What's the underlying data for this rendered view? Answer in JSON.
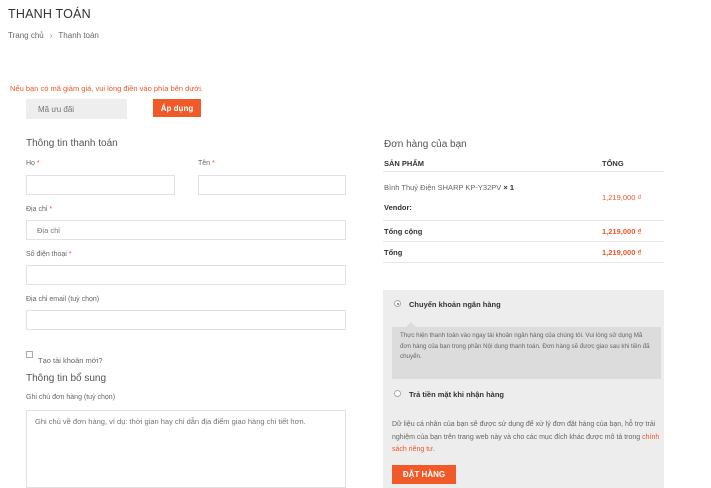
{
  "page": {
    "title": "THANH TOÁN"
  },
  "breadcrumb": {
    "home": "Trang chủ",
    "separator": "›",
    "current": "Thanh toán"
  },
  "coupon": {
    "note": "Nếu bạn có mã giảm giá, vui lòng điền vào phía bên dưới.",
    "placeholder": "Mã ưu đãi",
    "apply_label": "Áp dụng"
  },
  "billing": {
    "title": "Thông tin thanh toán",
    "last_name_label": "Họ",
    "first_name_label": "Tên",
    "address_label": "Địa chỉ",
    "address_placeholder": "Địa chỉ",
    "phone_label": "Số điện thoại",
    "email_label": "Địa chỉ email (tuỳ chọn)",
    "required_mark": "*",
    "create_account_label": "Tạo tài khoản mới?"
  },
  "additional": {
    "title": "Thông tin bổ sung",
    "notes_label": "Ghi chú đơn hàng (tuỳ chọn)",
    "notes_placeholder": "Ghi chú về đơn hàng, ví dụ: thời gian hay chỉ dẫn địa điểm giao hàng chi tiết hơn."
  },
  "order": {
    "title": "Đơn hàng của bạn",
    "col_product": "SẢN PHẨM",
    "col_total": "TỔNG",
    "item_name": "Bình Thuỷ Điện SHARP KP-Y32PV",
    "item_qty": "× 1",
    "item_vendor": "Vendor:",
    "item_price": "1,219,000 ₫",
    "subtotal_label": "Tổng cộng",
    "subtotal_value": "1,219,000 ₫",
    "total_label": "Tổng",
    "total_value": "1,219,000 ₫"
  },
  "payment": {
    "bank_label": "Chuyển khoản ngân hàng",
    "bank_desc": "Thực hiện thanh toán vào ngay tài khoản ngân hàng của chúng tôi. Vui lòng sử dụng Mã đơn hàng của bạn trong phần Nội dung thanh toán. Đơn hàng sẽ đươc giao sau khi tiền đã chuyển.",
    "cod_label": "Trả tiền mặt khi nhận hàng",
    "privacy_text": "Dữ liệu cá nhân của bạn sẽ được sử dụng để xử lý đơn đặt hàng của bạn, hỗ trợ trải nghiệm của bạn trên trang web này và cho các mục đích khác được mô tả trong",
    "privacy_link": "chính sách riêng tư",
    "privacy_end": ".",
    "place_order_label": "ĐẶT HÀNG"
  }
}
